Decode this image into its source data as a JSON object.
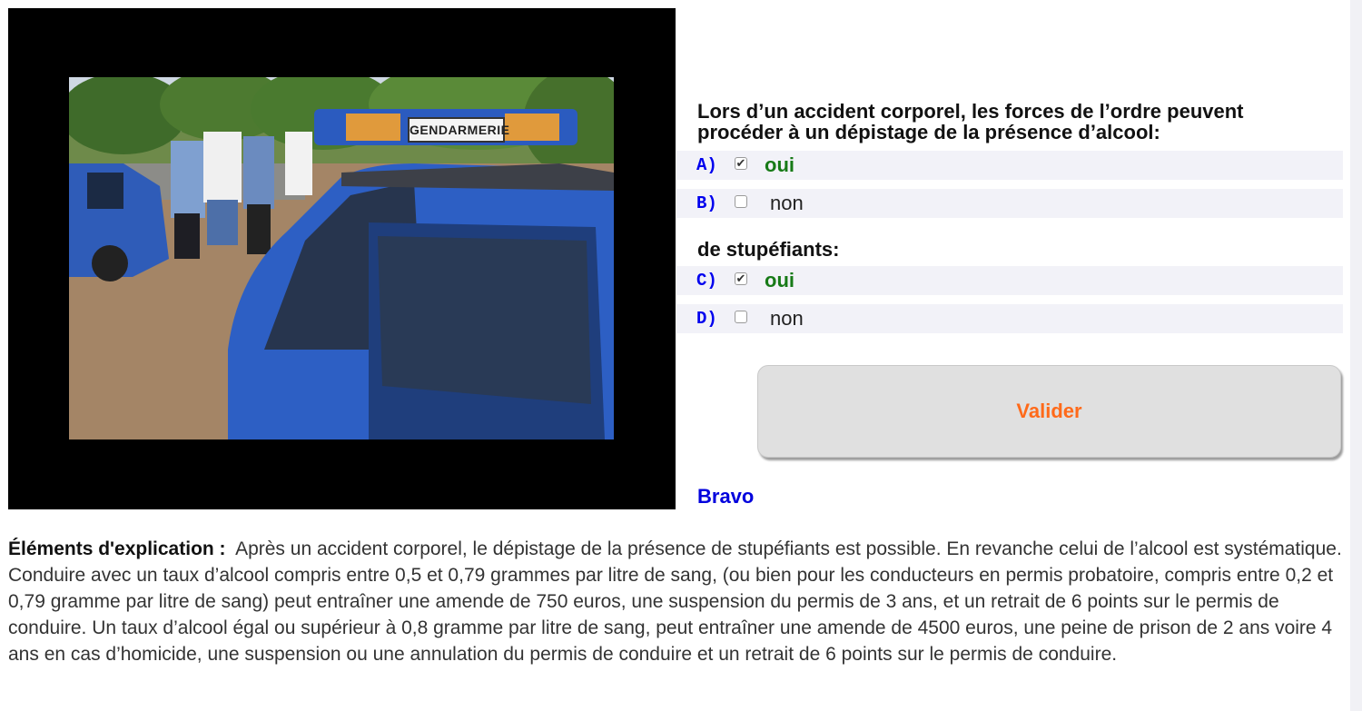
{
  "photo": {
    "sign_text": "GENDARMERIE"
  },
  "question": {
    "text": "Lors d’un accident corporel, les forces de l’ordre peuvent procéder à un dépistage de la présence d’alcool:",
    "sub_text": "de stupéfiants:"
  },
  "answers": [
    {
      "letter": "A)",
      "label": "oui",
      "checked": true,
      "check_glyph": "✔"
    },
    {
      "letter": "B)",
      "label": "non",
      "checked": false,
      "check_glyph": ""
    },
    {
      "letter": "C)",
      "label": "oui",
      "checked": true,
      "check_glyph": "✔"
    },
    {
      "letter": "D)",
      "label": "non",
      "checked": false,
      "check_glyph": ""
    }
  ],
  "validate_button": {
    "label": "Valider",
    "color": "#ff6a1a"
  },
  "feedback": {
    "text": "Bravo",
    "color": "#0000dd"
  },
  "explanation": {
    "title": "Éléments d'explication :",
    "body": "Après un accident corporel, le dépistage de la présence de stupéfiants est possible. En revanche celui de l’alcool est systématique. Conduire avec un taux d’alcool compris entre 0,5 et 0,79 grammes par litre de sang, (ou bien pour les conducteurs en permis probatoire, compris entre 0,2 et 0,79 gramme par litre de sang) peut entraîner une amende de 750 euros, une suspension du permis de 3 ans, et un retrait de 6 points sur le permis de conduire. Un taux d’alcool égal ou supérieur à 0,8 gramme par litre de sang, peut entraîner une amende de 4500 euros, une peine de prison de 2 ans voire 4 ans en cas d’homicide, une suspension ou une annulation du permis de conduire et un retrait de 6 points sur le permis de conduire."
  },
  "colors": {
    "correct_answer": "#177a17",
    "answer_letter": "#0000ee",
    "row_background": "#f2f2f8"
  }
}
